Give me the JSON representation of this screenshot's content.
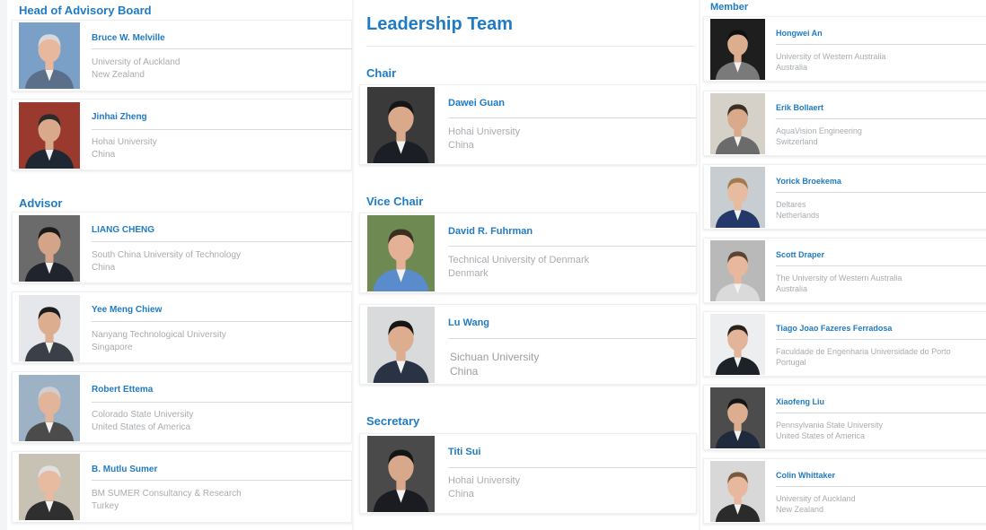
{
  "left": {
    "head_title": "Head of Advisory Board",
    "advisor_title": "Advisor",
    "head": [
      {
        "name": "Bruce W. Melville",
        "line1": "University of Auckland",
        "line2": "New Zealand",
        "photo": {
          "bg": "#7aa0c8",
          "skin": "#e8b89e",
          "hair": "#d8d8d8",
          "suit": "#5b6f8a"
        }
      },
      {
        "name": "Jinhai Zheng",
        "line1": "Hohai University",
        "line2": "China",
        "photo": {
          "bg": "#9a3a2f",
          "skin": "#d9a98c",
          "hair": "#2b2b2b",
          "suit": "#1f2733"
        }
      }
    ],
    "advisors": [
      {
        "name": "LIANG CHENG",
        "line1": "South China University of Technology",
        "line2": "China",
        "photo": {
          "bg": "#6b6b6b",
          "skin": "#d3a488",
          "hair": "#1a1a1a",
          "suit": "#20242c"
        }
      },
      {
        "name": "Yee Meng Chiew",
        "line1": "Nanyang Technological University",
        "line2": "Singapore",
        "photo": {
          "bg": "#e5e7ea",
          "skin": "#dcae8f",
          "hair": "#1d1d1d",
          "suit": "#3b4048"
        }
      },
      {
        "name": "Robert Ettema",
        "line1": "Colorado State University",
        "line2": "United States of America",
        "photo": {
          "bg": "#9eb2c6",
          "skin": "#e2b59a",
          "hair": "#cfcfcf",
          "suit": "#4b4b4b"
        }
      },
      {
        "name": "B. Mutlu Sumer",
        "line1": "BM SUMER Consultancy & Research",
        "line2": "Turkey",
        "photo": {
          "bg": "#c8c2b4",
          "skin": "#e6bba0",
          "hair": "#e0e0e0",
          "suit": "#2f2f2f"
        }
      }
    ]
  },
  "mid": {
    "title": "Leadership Team",
    "chair_title": "Chair",
    "vice_title": "Vice Chair",
    "secretary_title": "Secretary",
    "chair": {
      "name": "Dawei Guan",
      "line1": "Hohai University",
      "line2": "China",
      "photo": {
        "bg": "#3a3a3a",
        "skin": "#d9a98c",
        "hair": "#151515",
        "suit": "#1b1e24"
      }
    },
    "vice": [
      {
        "name": "David R. Fuhrman",
        "line1": "Technical University of Denmark",
        "line2": "Denmark",
        "photo": {
          "bg": "#6e8a52",
          "skin": "#e4b197",
          "hair": "#3a2d22",
          "suit": "#5a8ccc"
        }
      },
      {
        "name": "Lu Wang",
        "line1": "Sichuan University",
        "line2": "China",
        "photo": {
          "bg": "#d9dadc",
          "skin": "#dcae8f",
          "hair": "#151515",
          "suit": "#2a3344"
        }
      }
    ],
    "secretary": {
      "name": "Titi Sui",
      "line1": "Hohai University",
      "line2": "China",
      "photo": {
        "bg": "#4a4a4a",
        "skin": "#d8a88a",
        "hair": "#151515",
        "suit": "#1a1c22"
      }
    }
  },
  "right": {
    "title": "Member",
    "members": [
      {
        "name": "Hongwei An",
        "line1": "University of Western Australia",
        "line2": "Australia",
        "photo": {
          "bg": "#1e1e1e",
          "skin": "#dcae8f",
          "hair": "#101010",
          "suit": "#7a7a7a"
        }
      },
      {
        "name": "Erik Bollaert",
        "line1": "AquaVision Engineering",
        "line2": "Switzerland",
        "photo": {
          "bg": "#d5d0c8",
          "skin": "#d9a98c",
          "hair": "#3b2e24",
          "suit": "#6b6b6b"
        }
      },
      {
        "name": "Yorick Broekema",
        "line1": "Deltares",
        "line2": "Netherlands",
        "photo": {
          "bg": "#c8cdd2",
          "skin": "#e6bba0",
          "hair": "#a27a4e",
          "suit": "#24386a"
        }
      },
      {
        "name": "Scott Draper",
        "line1": "The University of Western Australia",
        "line2": "Australia",
        "photo": {
          "bg": "#b9b9b9",
          "skin": "#e8b89e",
          "hair": "#5a4330",
          "suit": "#dadada"
        }
      },
      {
        "name": "Tiago Joao Fazeres Ferradosa",
        "line1": "Faculdade de Engenharia Universidade do Porto",
        "line2": "Portugal",
        "photo": {
          "bg": "#eceef0",
          "skin": "#e2b59a",
          "hair": "#2a2218",
          "suit": "#1d2128"
        }
      },
      {
        "name": "Xiaofeng Liu",
        "line1": "Pennsylvania State University",
        "line2": "United States of America",
        "photo": {
          "bg": "#4c4c4c",
          "skin": "#dcae8f",
          "hair": "#151515",
          "suit": "#1f2a3c"
        }
      },
      {
        "name": "Colin Whittaker",
        "line1": "University of Auckland",
        "line2": "New Zealand",
        "photo": {
          "bg": "#d8d8d8",
          "skin": "#e8b89e",
          "hair": "#7a5a3c",
          "suit": "#2b2b2b"
        }
      }
    ]
  }
}
